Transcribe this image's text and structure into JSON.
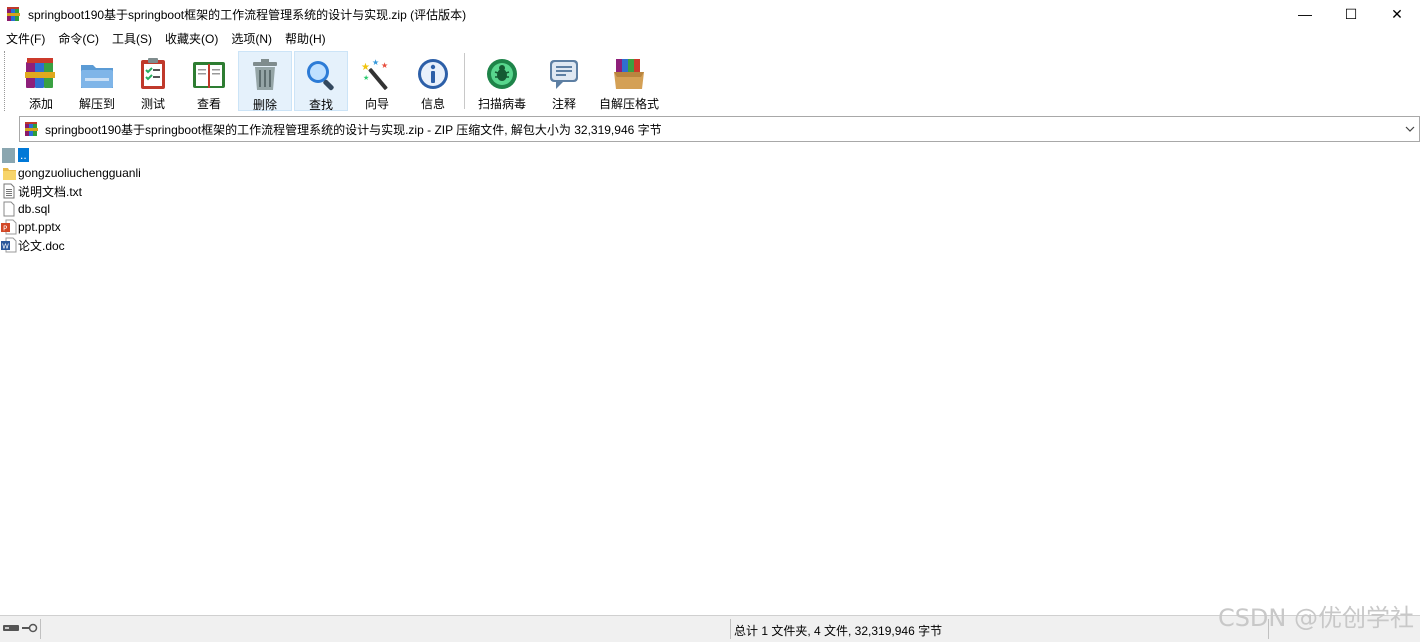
{
  "window": {
    "title": "springboot190基于springboot框架的工作流程管理系统的设计与实现.zip (评估版本)",
    "minimize": "—",
    "maximize": "☐",
    "close": "✕"
  },
  "menu": [
    {
      "label": "文件(F)"
    },
    {
      "label": "命令(C)"
    },
    {
      "label": "工具(S)"
    },
    {
      "label": "收藏夹(O)"
    },
    {
      "label": "选项(N)"
    },
    {
      "label": "帮助(H)"
    }
  ],
  "toolbar": {
    "add": "添加",
    "extract": "解压到",
    "test": "测试",
    "view": "查看",
    "delete": "删除",
    "find": "查找",
    "wizard": "向导",
    "info": "信息",
    "scan": "扫描病毒",
    "comment": "注释",
    "sfx": "自解压格式"
  },
  "address": {
    "text": "springboot190基于springboot框架的工作流程管理系统的设计与实现.zip - ZIP 压缩文件, 解包大小为 32,319,946 字节"
  },
  "files": [
    {
      "name": "..",
      "icon": "parent-folder-icon"
    },
    {
      "name": "gongzuoliuchengguanli",
      "icon": "folder-icon"
    },
    {
      "name": "说明文档.txt",
      "icon": "text-file-icon"
    },
    {
      "name": "db.sql",
      "icon": "file-icon"
    },
    {
      "name": "ppt.pptx",
      "icon": "powerpoint-icon"
    },
    {
      "name": "论文.doc",
      "icon": "word-icon"
    }
  ],
  "status": {
    "summary": "总计 1 文件夹, 4 文件, 32,319,946 字节"
  },
  "watermark": "CSDN @优创学社"
}
